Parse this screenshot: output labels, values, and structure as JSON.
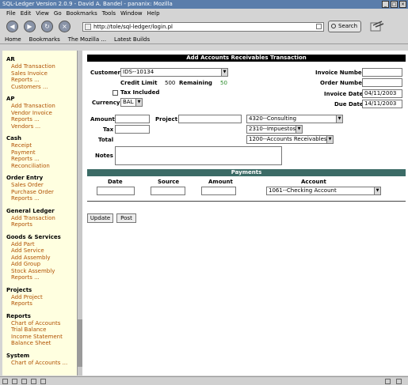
{
  "window": {
    "title": "SQL-Ledger Version 2.0.9 - David A. Bandel - pananix: Mozilla"
  },
  "menu": {
    "items": [
      "File",
      "Edit",
      "View",
      "Go",
      "Bookmarks",
      "Tools",
      "Window",
      "Help"
    ]
  },
  "nav": {
    "url": "http://tole/sql-ledger/login.pl",
    "search_label": "Search"
  },
  "bookmarks": {
    "items": [
      "Home",
      "Bookmarks",
      "The Mozilla ...",
      "Latest Builds"
    ]
  },
  "sidebar": {
    "sections": [
      {
        "title": "AR",
        "links": [
          "Add Transaction",
          "Sales Invoice",
          "Reports ...",
          "Customers ..."
        ]
      },
      {
        "title": "AP",
        "links": [
          "Add Transaction",
          "Vendor Invoice",
          "Reports ...",
          "Vendors ..."
        ]
      },
      {
        "title": "Cash",
        "links": [
          "Receipt",
          "Payment",
          "Reports ...",
          "Reconciliation"
        ]
      },
      {
        "title": "Order Entry",
        "links": [
          "Sales Order",
          "Purchase Order",
          "Reports ..."
        ]
      },
      {
        "title": "General Ledger",
        "links": [
          "Add Transaction",
          "Reports"
        ]
      },
      {
        "title": "Goods & Services",
        "links": [
          "Add Part",
          "Add Service",
          "Add Assembly",
          "Add Group",
          "Stock Assembly",
          "Reports ..."
        ]
      },
      {
        "title": "Projects",
        "links": [
          "Add Project",
          "Reports"
        ]
      },
      {
        "title": "Reports",
        "links": [
          "Chart of Accounts",
          "Trial Balance",
          "Income Statement",
          "Balance Sheet"
        ]
      },
      {
        "title": "System",
        "links": [
          "Chart of Accounts ..."
        ]
      }
    ]
  },
  "form": {
    "title": "Add Accounts Receivables Transaction",
    "customer_label": "Customer",
    "customer_value": "IDS--10134",
    "credit_limit_label": "Credit Limit",
    "credit_limit_value": "500",
    "remaining_label": "Remaining",
    "remaining_value": "50",
    "tax_included_label": "Tax Included",
    "currency_label": "Currency",
    "currency_value": "BAL",
    "invoice_number_label": "Invoice Number",
    "invoice_number_value": "",
    "order_number_label": "Order Number",
    "order_number_value": "",
    "invoice_date_label": "Invoice Date",
    "invoice_date_value": "04/11/2003",
    "due_date_label": "Due Date",
    "due_date_value": "14/11/2003",
    "amount_label": "Amount",
    "project_label": "Project",
    "tax_label": "Tax",
    "total_label": "Total",
    "notes_label": "Notes",
    "income_account": "4320--Consulting",
    "tax_account": "2310--Impuestos",
    "ar_account": "1200--Accounts Receivables",
    "remaining_color": "#2a8a2a"
  },
  "payments": {
    "title": "Payments",
    "date_label": "Date",
    "source_label": "Source",
    "amount_label": "Amount",
    "account_label": "Account",
    "account_value": "1061--Checking Account"
  },
  "buttons": {
    "update_label": "Update",
    "post_label": "Post"
  }
}
